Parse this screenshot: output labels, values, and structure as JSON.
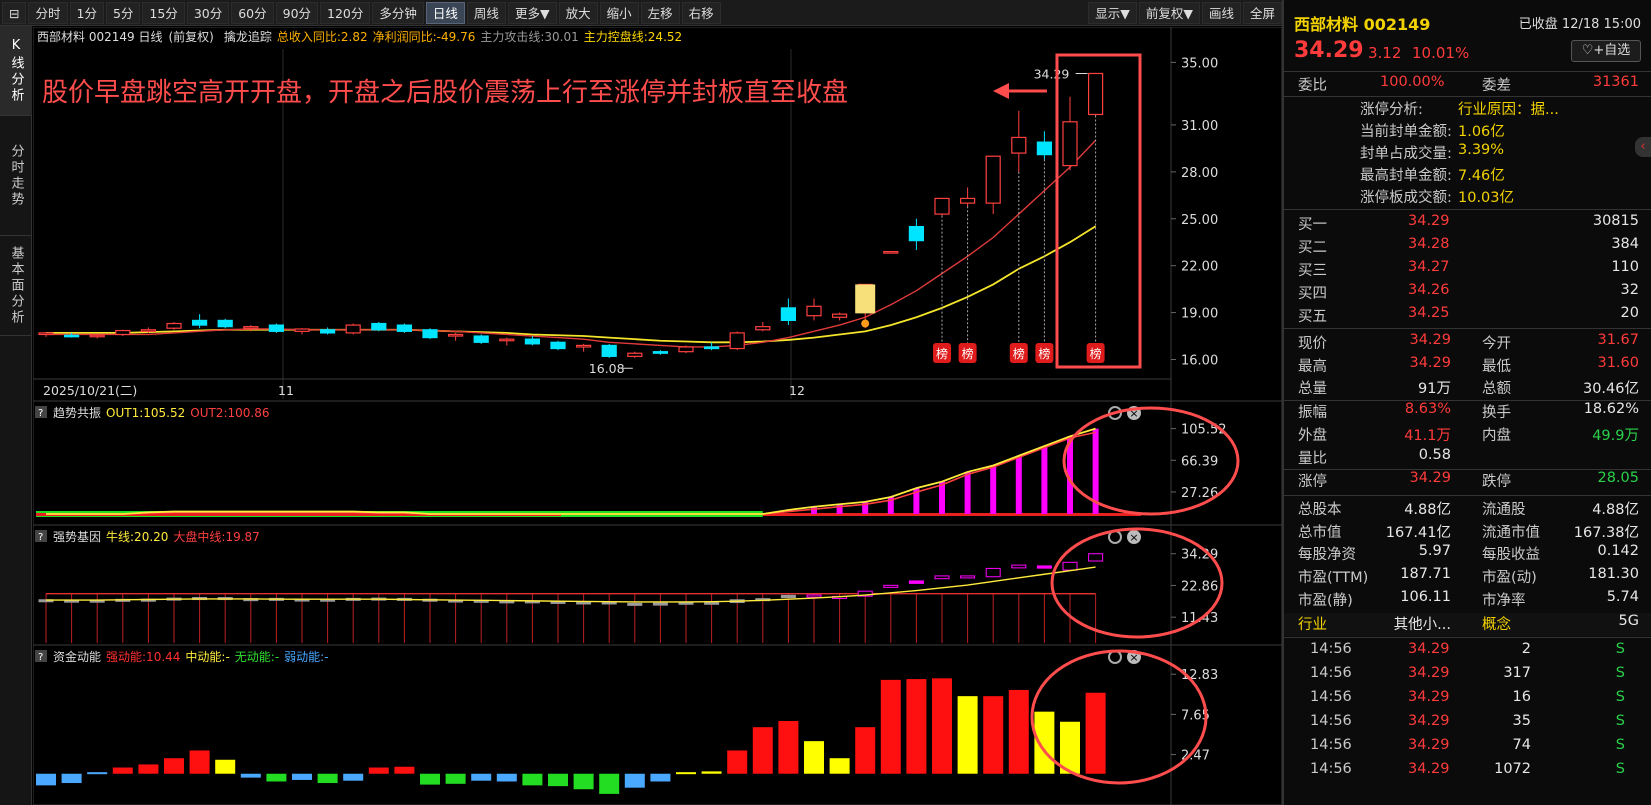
{
  "toolbar": {
    "icon_label": "⊟",
    "periods": [
      "分时",
      "1分",
      "5分",
      "15分",
      "30分",
      "60分",
      "90分",
      "120分",
      "多分钟",
      "日线",
      "周线",
      "更多▼",
      "放大",
      "缩小",
      "左移",
      "右移"
    ],
    "active_period": "日线",
    "right_items": [
      "显示▼",
      "前复权▼",
      "画线",
      "全屏"
    ]
  },
  "sidetabs": [
    "K线分析",
    "分时走势",
    "基本面分析"
  ],
  "main_chart": {
    "header_name": "西部材料 002149 日线",
    "header_adj": "(前复权)",
    "indicator": "擒龙追踪",
    "ind_items": [
      {
        "text": "总收入同比:2.82",
        "color": "#ffb000"
      },
      {
        "text": "净利润同比:-49.76",
        "color": "#ffb000"
      },
      {
        "text": "主力攻击线:30.01",
        "color": "#9a9a9a"
      },
      {
        "text": "主力控盘线:24.52",
        "color": "#ffd800"
      }
    ],
    "annotation": "股价早盘跳空高开开盘，开盘之后股价震荡上行至涨停并封板直至收盘",
    "high_label": "34.29",
    "low_label": "16.08",
    "badge_label": "榜",
    "y_ticks": [
      "35.00",
      "31.00",
      "28.00",
      "25.00",
      "22.00",
      "19.00",
      "16.00"
    ],
    "date_start": "2025/10/21(二)",
    "month_labels": [
      "11",
      "12"
    ]
  },
  "sub1": {
    "title": "趋势共振",
    "items": [
      {
        "text": "OUT1:105.52",
        "color": "#ffeb3b"
      },
      {
        "text": "OUT2:100.86",
        "color": "#ff4040"
      }
    ],
    "y_ticks": [
      "105.52",
      "66.39",
      "27.26"
    ]
  },
  "sub2": {
    "title": "强势基因",
    "items": [
      {
        "text": "牛线:20.20",
        "color": "#ffeb3b"
      },
      {
        "text": "大盘中线:19.87",
        "color": "#ff4040"
      }
    ],
    "y_ticks": [
      "34.29",
      "22.86",
      "11.43"
    ]
  },
  "sub3": {
    "title": "资金动能",
    "items": [
      {
        "text": "强动能:10.44",
        "color": "#ff3030"
      },
      {
        "text": "中动能:-",
        "color": "#ffeb3b"
      },
      {
        "text": "无动能:-",
        "color": "#30e030"
      },
      {
        "text": "弱动能:-",
        "color": "#4aa8ff"
      }
    ],
    "y_ticks": [
      "12.83",
      "7.65",
      "2.47"
    ]
  },
  "chart_data": [
    {
      "type": "candlestick",
      "title": "西部材料 002149 日线",
      "ylim": [
        15.2,
        35.6
      ],
      "y_ticks": [
        35.0,
        31.0,
        28.0,
        25.0,
        22.0,
        19.0,
        16.0
      ],
      "ohlc": [
        [
          17.6,
          17.75,
          17.45,
          17.7
        ],
        [
          17.55,
          17.7,
          17.4,
          17.5
        ],
        [
          17.5,
          17.65,
          17.35,
          17.55
        ],
        [
          17.6,
          17.9,
          17.5,
          17.85
        ],
        [
          17.8,
          18.05,
          17.7,
          17.9
        ],
        [
          18.0,
          18.4,
          17.9,
          18.3
        ],
        [
          18.5,
          18.9,
          18.0,
          18.2
        ],
        [
          18.5,
          18.6,
          18.0,
          18.1
        ],
        [
          18.0,
          18.2,
          17.8,
          18.1
        ],
        [
          18.2,
          18.3,
          17.7,
          17.8
        ],
        [
          17.8,
          18.0,
          17.6,
          17.95
        ],
        [
          17.9,
          18.05,
          17.6,
          17.7
        ],
        [
          17.7,
          18.3,
          17.6,
          18.2
        ],
        [
          18.3,
          18.4,
          17.8,
          17.9
        ],
        [
          18.2,
          18.3,
          17.7,
          17.8
        ],
        [
          17.9,
          18.0,
          17.3,
          17.4
        ],
        [
          17.5,
          17.7,
          17.2,
          17.6
        ],
        [
          17.5,
          17.6,
          17.0,
          17.1
        ],
        [
          17.2,
          17.4,
          16.9,
          17.3
        ],
        [
          17.3,
          17.5,
          16.9,
          17.0
        ],
        [
          17.1,
          17.2,
          16.6,
          16.7
        ],
        [
          16.8,
          17.0,
          16.5,
          16.9
        ],
        [
          16.9,
          17.0,
          16.1,
          16.2
        ],
        [
          16.2,
          16.5,
          16.08,
          16.4
        ],
        [
          16.5,
          16.6,
          16.3,
          16.4
        ],
        [
          16.5,
          16.9,
          16.4,
          16.8
        ],
        [
          16.8,
          17.1,
          16.6,
          16.7
        ],
        [
          16.7,
          17.8,
          16.6,
          17.7
        ],
        [
          17.9,
          18.4,
          17.8,
          18.1
        ],
        [
          19.3,
          19.9,
          18.2,
          18.5
        ],
        [
          18.8,
          19.9,
          18.5,
          19.4
        ],
        [
          18.7,
          19.0,
          18.5,
          18.9
        ],
        [
          19.0,
          20.8,
          18.0,
          20.8
        ],
        [
          22.9,
          22.9,
          22.9,
          22.9
        ],
        [
          24.5,
          25.0,
          23.0,
          23.6
        ],
        [
          25.3,
          26.3,
          25.2,
          26.3
        ],
        [
          26.0,
          27.0,
          25.8,
          26.3
        ],
        [
          26.0,
          29.0,
          25.3,
          29.0
        ],
        [
          29.2,
          31.9,
          28.0,
          30.2
        ],
        [
          29.9,
          30.6,
          28.8,
          29.1
        ],
        [
          28.4,
          32.8,
          28.1,
          31.2
        ],
        [
          31.67,
          34.29,
          31.6,
          34.29
        ]
      ],
      "ma_attack": [
        17.6,
        17.6,
        17.6,
        17.6,
        17.6,
        17.7,
        17.8,
        17.9,
        17.95,
        17.95,
        17.9,
        17.9,
        17.9,
        17.9,
        17.9,
        17.85,
        17.8,
        17.7,
        17.6,
        17.5,
        17.4,
        17.3,
        17.1,
        17.0,
        16.9,
        16.8,
        16.8,
        16.9,
        17.1,
        17.4,
        17.8,
        18.2,
        18.7,
        19.5,
        20.4,
        21.5,
        22.6,
        23.8,
        25.3,
        26.8,
        28.3,
        30.01
      ],
      "ma_control": [
        17.7,
        17.7,
        17.7,
        17.7,
        17.75,
        17.8,
        17.85,
        17.9,
        17.9,
        17.9,
        17.9,
        17.9,
        17.9,
        17.9,
        17.9,
        17.85,
        17.8,
        17.75,
        17.7,
        17.6,
        17.55,
        17.5,
        17.4,
        17.3,
        17.2,
        17.15,
        17.1,
        17.1,
        17.15,
        17.25,
        17.4,
        17.6,
        17.8,
        18.2,
        18.7,
        19.3,
        20.0,
        20.8,
        21.8,
        22.6,
        23.5,
        24.52
      ],
      "badge_index": [
        35,
        36,
        38,
        39,
        41
      ]
    },
    {
      "type": "bar",
      "title": "趋势共振",
      "series": [
        {
          "name": "OUT1",
          "values": [
            0,
            0,
            0,
            0,
            2,
            3,
            3,
            3,
            3,
            3,
            3,
            3,
            3,
            2,
            2,
            0,
            0,
            0,
            0,
            0,
            0,
            0,
            0,
            0,
            0,
            0,
            0,
            0,
            0,
            5,
            9,
            12,
            15,
            21,
            32,
            40,
            52,
            60,
            72,
            84,
            96,
            105.52
          ]
        },
        {
          "name": "OUT2",
          "values": [
            0,
            0,
            0,
            0,
            1,
            2,
            2,
            2,
            2,
            2,
            2,
            2,
            2,
            1,
            1,
            0,
            0,
            0,
            0,
            0,
            0,
            0,
            0,
            0,
            0,
            0,
            0,
            0,
            0,
            3,
            6,
            9,
            12,
            17,
            27,
            36,
            49,
            58,
            70,
            82,
            94,
            100.86
          ]
        }
      ],
      "ylim": [
        0,
        110
      ]
    },
    {
      "type": "bar",
      "title": "强势基因",
      "series": [
        {
          "name": "牛线",
          "values": [
            17.6,
            17.6,
            17.6,
            17.7,
            17.8,
            17.9,
            18.0,
            18.0,
            18.0,
            17.9,
            17.9,
            17.9,
            17.9,
            17.9,
            17.8,
            17.7,
            17.6,
            17.5,
            17.4,
            17.3,
            17.2,
            17.1,
            17.0,
            16.9,
            16.9,
            16.9,
            17.0,
            17.2,
            17.5,
            17.9,
            18.3,
            18.8,
            19.4,
            20.2,
            21.0,
            22.0,
            23.0,
            24.3,
            25.6,
            26.9,
            28.2,
            29.5
          ]
        },
        {
          "name": "大盘中线",
          "values": [
            19.9,
            19.9,
            19.9,
            19.9,
            19.9,
            19.9,
            19.9,
            19.9,
            19.9,
            19.9,
            19.9,
            19.9,
            19.9,
            19.9,
            19.9,
            19.9,
            19.9,
            19.9,
            19.9,
            19.9,
            19.9,
            19.9,
            19.9,
            19.9,
            19.9,
            19.9,
            19.9,
            19.9,
            19.9,
            19.9,
            19.9,
            19.9,
            19.9,
            19.9,
            19.9,
            19.9,
            19.9,
            19.9,
            19.9,
            19.9,
            19.9,
            19.87
          ]
        }
      ],
      "ylim": [
        5,
        36
      ]
    },
    {
      "type": "bar",
      "title": "资金动能",
      "values": [
        -1.5,
        -1.2,
        0.2,
        0.8,
        1.2,
        2.0,
        3.0,
        1.8,
        -0.5,
        -1.0,
        -0.8,
        -1.2,
        -0.9,
        0.8,
        0.9,
        -1.4,
        -1.3,
        -0.9,
        -1.0,
        -1.5,
        -1.6,
        -2.0,
        -2.6,
        -1.8,
        -1.0,
        0.2,
        0.3,
        3.0,
        6.0,
        6.8,
        4.2,
        2.0,
        6.0,
        12.1,
        12.2,
        12.3,
        10.0,
        10.0,
        10.8,
        8.0,
        6.7,
        10.44
      ],
      "colors": [
        "blue",
        "blue",
        "blue",
        "red",
        "red",
        "red",
        "red",
        "yellow",
        "blue",
        "green",
        "blue",
        "green",
        "blue",
        "red",
        "red",
        "green",
        "green",
        "blue",
        "blue",
        "green",
        "green",
        "green",
        "green",
        "blue",
        "blue",
        "yellow",
        "yellow",
        "red",
        "red",
        "red",
        "yellow",
        "yellow",
        "red",
        "red",
        "red",
        "red",
        "yellow",
        "red",
        "red",
        "yellow",
        "yellow",
        "red"
      ],
      "ylim": [
        -3,
        13.5
      ]
    }
  ],
  "panel": {
    "name": "西部材料 002149",
    "status": "已收盘 12/18 15:00",
    "price": "34.29",
    "change": "3.12",
    "pct": "10.01%",
    "fav_label": "♡+自选",
    "weibi_label": "委比",
    "weibi_value": "100.00%",
    "weicha_label": "委差",
    "weicha_value": "31361",
    "limit_info": [
      {
        "label": "涨停分析:",
        "value": "行业原因：据..."
      },
      {
        "label": "当前封单金额:",
        "value": "1.06亿"
      },
      {
        "label": "封单占成交量:",
        "value": "3.39%"
      },
      {
        "label": "最高封单金额:",
        "value": "7.46亿"
      },
      {
        "label": "涨停板成交额:",
        "value": "10.03亿"
      }
    ],
    "bids": [
      {
        "label": "买一",
        "price": "34.29",
        "vol": "30815"
      },
      {
        "label": "买二",
        "price": "34.28",
        "vol": "384"
      },
      {
        "label": "买三",
        "price": "34.27",
        "vol": "110"
      },
      {
        "label": "买四",
        "price": "34.26",
        "vol": "32"
      },
      {
        "label": "买五",
        "price": "34.25",
        "vol": "20"
      }
    ],
    "stats": [
      [
        {
          "l": "现价",
          "v": "34.29",
          "c": "red"
        },
        {
          "l": "今开",
          "v": "31.67",
          "c": "red"
        }
      ],
      [
        {
          "l": "最高",
          "v": "34.29",
          "c": "red"
        },
        {
          "l": "最低",
          "v": "31.60",
          "c": "red"
        }
      ],
      [
        {
          "l": "总量",
          "v": "91万",
          "c": "wht"
        },
        {
          "l": "总额",
          "v": "30.46亿",
          "c": "wht"
        }
      ],
      [
        {
          "l": "振幅",
          "v": "8.63%",
          "c": "red"
        },
        {
          "l": "换手",
          "v": "18.62%",
          "c": "wht"
        }
      ],
      [
        {
          "l": "外盘",
          "v": "41.1万",
          "c": "red"
        },
        {
          "l": "内盘",
          "v": "49.9万",
          "c": "grn"
        }
      ],
      [
        {
          "l": "量比",
          "v": "0.58",
          "c": "wht"
        }
      ],
      [
        {
          "l": "涨停",
          "v": "34.29",
          "c": "red"
        },
        {
          "l": "跌停",
          "v": "28.05",
          "c": "grn"
        }
      ],
      [
        {
          "l": "总股本",
          "v": "4.88亿",
          "c": "wht"
        },
        {
          "l": "流通股",
          "v": "4.88亿",
          "c": "wht"
        }
      ],
      [
        {
          "l": "总市值",
          "v": "167.41亿",
          "c": "wht"
        },
        {
          "l": "流通市值",
          "v": "167.38亿",
          "c": "wht"
        }
      ],
      [
        {
          "l": "每股净资",
          "v": "5.97",
          "c": "wht"
        },
        {
          "l": "每股收益",
          "v": "0.142",
          "c": "wht"
        }
      ],
      [
        {
          "l": "市盈(TTM)",
          "v": "187.71",
          "c": "wht"
        },
        {
          "l": "市盈(动)",
          "v": "181.30",
          "c": "wht"
        }
      ],
      [
        {
          "l": "市盈(静)",
          "v": "106.11",
          "c": "wht"
        },
        {
          "l": "市净率",
          "v": "5.74",
          "c": "wht"
        }
      ]
    ],
    "industry_label": "行业",
    "industry_value": "其他小...",
    "concept_label": "概念",
    "concept_value": "5G",
    "ticks": [
      {
        "t": "14:56",
        "p": "34.29",
        "v": "2",
        "d": "S"
      },
      {
        "t": "14:56",
        "p": "34.29",
        "v": "317",
        "d": "S"
      },
      {
        "t": "14:56",
        "p": "34.29",
        "v": "16",
        "d": "S"
      },
      {
        "t": "14:56",
        "p": "34.29",
        "v": "35",
        "d": "S"
      },
      {
        "t": "14:56",
        "p": "34.29",
        "v": "74",
        "d": "S"
      },
      {
        "t": "14:56",
        "p": "34.29",
        "v": "1072",
        "d": "S"
      }
    ]
  },
  "colors": {
    "up": "#ff3b3b",
    "down": "#2bd04a",
    "cyan": "#00e5ff",
    "magenta": "#ff00ff",
    "yellow": "#ffeb3b",
    "highlight": "#ff4d4d"
  }
}
